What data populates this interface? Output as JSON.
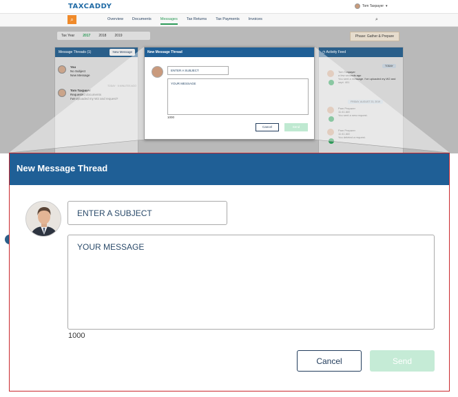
{
  "app": {
    "logo": "TAXCADDY",
    "user_name": "Tom Taxpayer",
    "user_caret": "▾"
  },
  "nav": {
    "items": [
      {
        "label": "Overview",
        "active": false
      },
      {
        "label": "Documents",
        "active": false
      },
      {
        "label": "Messages",
        "active": true
      },
      {
        "label": "Tax Returns",
        "active": false
      },
      {
        "label": "Tax Payments",
        "active": false
      },
      {
        "label": "Invoices",
        "active": false
      }
    ]
  },
  "tax_year": {
    "label": "Tax Year",
    "years": [
      "2017",
      "2018",
      "2019"
    ],
    "selected": "2017"
  },
  "phase": "Phase: Gather & Prepare",
  "threads_panel": {
    "title": "Message Threads (1)",
    "new_button": "New Message",
    "threads": [
      {
        "name": "You",
        "line1": "No Subject",
        "line2": "New Message",
        "date": ""
      },
      {
        "name": "Tom Taxpayer",
        "line1": "Requested documents",
        "line2": "I've uploaded my W2 and request?",
        "date": "TODAY · 5 MINUTES AGO"
      }
    ]
  },
  "activity_panel": {
    "title": "Activity Feed",
    "day1": "TODAY",
    "day2": "FRIDAY, AUGUST 23, 2019",
    "rows": [
      {
        "name": "Tom Taxpayer",
        "time": "a few seconds ago",
        "text": "You sent a message. I've uploaded my W2 and sept. 401"
      },
      {
        "name": "Pam Preparer",
        "time": "11:41 AM",
        "text": "You sent a new request."
      },
      {
        "name": "Pam Preparer",
        "time": "11:41 AM",
        "text": "You deleted a request."
      }
    ]
  },
  "modal": {
    "title": "New Message Thread",
    "subject_placeholder": "ENTER A SUBJECT",
    "message_placeholder": "YOUR MESSAGE",
    "char_count": "1000",
    "cancel_label": "Cancel",
    "send_label": "Send"
  },
  "colors": {
    "header_blue": "#1f5f96",
    "accent_green": "#2b9a57",
    "send_disabled": "#c5ebd6",
    "zoom_frame": "#c9252a"
  }
}
